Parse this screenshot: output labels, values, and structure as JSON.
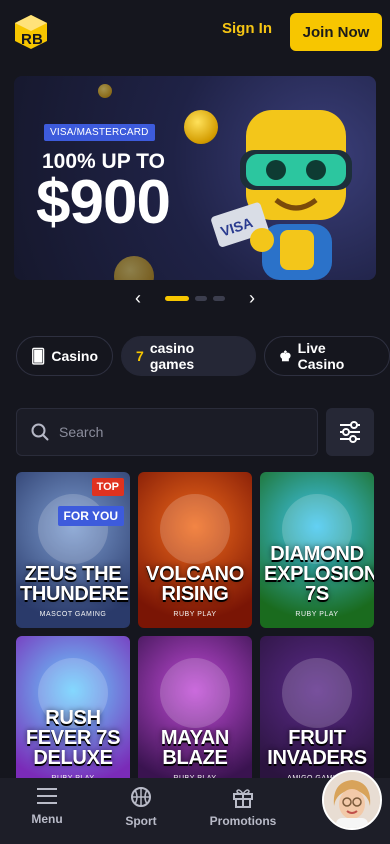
{
  "header": {
    "signin_label": "Sign In",
    "join_label": "Join Now"
  },
  "banner": {
    "badge": "VISA/MASTERCARD",
    "headline": "100% UP TO",
    "amount": "$900",
    "card_text": "VISA",
    "slide_index": 1,
    "slide_count": 3
  },
  "categories": [
    {
      "label": "Casino",
      "icon": "cards-icon",
      "active": false
    },
    {
      "label": "casino games",
      "icon": "seven-icon",
      "active": true
    },
    {
      "label": "Live Casino",
      "icon": "chess-king-icon",
      "active": false
    }
  ],
  "search": {
    "placeholder": "Search"
  },
  "games": [
    {
      "title": "ZEUS THE THUNDERER",
      "provider": "MASCOT GAMING",
      "tags": [
        "TOP",
        "FOR YOU"
      ],
      "colors": [
        "#7b9bcf",
        "#2a3a6a"
      ]
    },
    {
      "title": "VOLCANO RISING",
      "provider": "RUBY PLAY",
      "tags": [],
      "colors": [
        "#f06a1b",
        "#7a1505"
      ]
    },
    {
      "title": "DIAMOND EXPLOSION 7S",
      "provider": "RUBY PLAY",
      "tags": [],
      "colors": [
        "#41c7f2",
        "#1a6b1e"
      ]
    },
    {
      "title": "RUSH FEVER 7S DELUXE",
      "provider": "RUBY PLAY",
      "tags": [],
      "colors": [
        "#6ad0ff",
        "#7a2bb8"
      ]
    },
    {
      "title": "MAYAN BLAZE",
      "provider": "RUBY PLAY",
      "tags": [],
      "colors": [
        "#c04bd6",
        "#3a1350"
      ]
    },
    {
      "title": "FRUIT INVADERS",
      "provider": "AMIGO GAMING",
      "tags": [],
      "colors": [
        "#5a2a88",
        "#2b143f"
      ]
    }
  ],
  "bottom_nav": [
    {
      "label": "Menu",
      "icon": "menu-icon"
    },
    {
      "label": "Sport",
      "icon": "basketball-icon"
    },
    {
      "label": "Promotions",
      "icon": "gift-icon"
    },
    {
      "label": "Su",
      "icon": "support-icon"
    }
  ]
}
